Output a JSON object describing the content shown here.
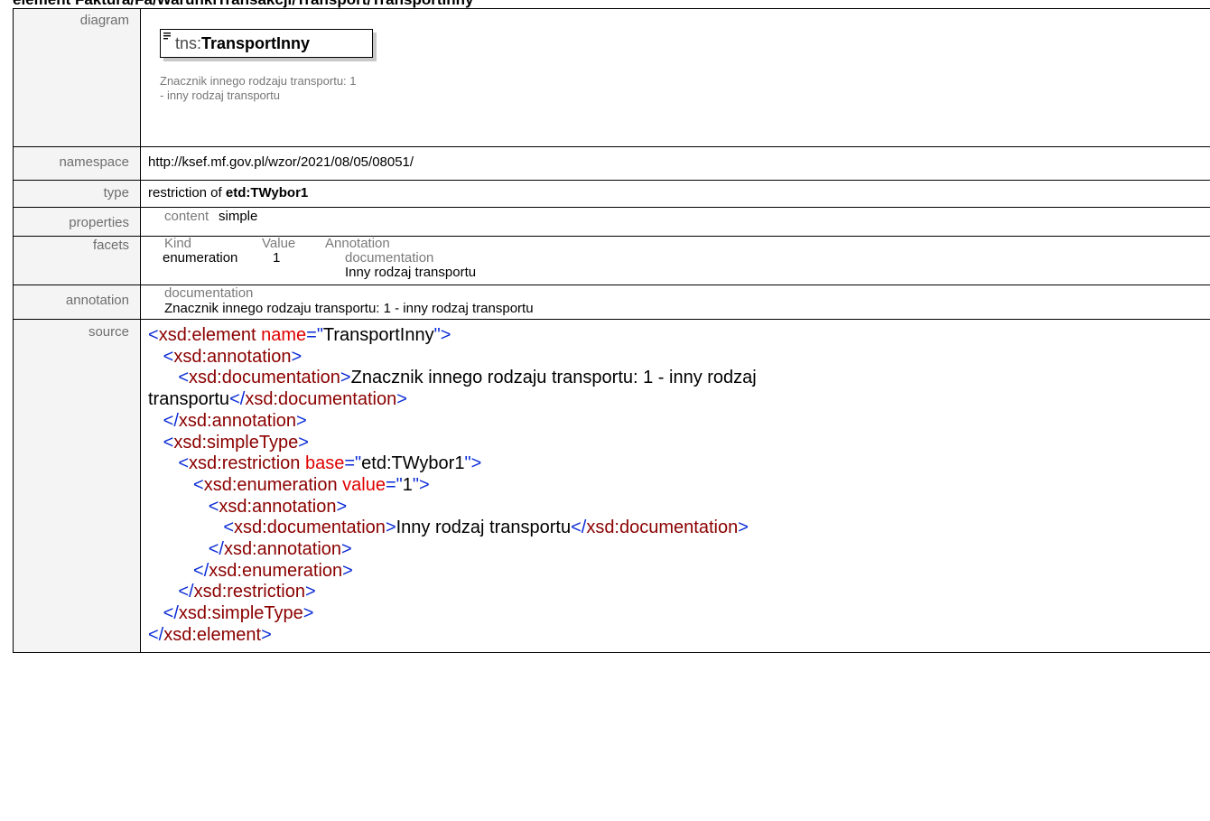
{
  "header": {
    "title": "element Faktura/Fa/WarunkiTransakcji/Transport/TransportInny"
  },
  "labels": {
    "diagram": "diagram",
    "namespace": "namespace",
    "type": "type",
    "properties": "properties",
    "facets": "facets",
    "annotation": "annotation",
    "source": "source"
  },
  "diagram": {
    "prefix": "tns:",
    "name": "TransportInny",
    "annotation": "Znacznik innego rodzaju transportu: 1 - inny rodzaj transportu"
  },
  "namespace": "http://ksef.mf.gov.pl/wzor/2021/08/05/08051/",
  "type": {
    "prefix": "restriction of ",
    "base": "etd:TWybor1"
  },
  "properties": {
    "key": "content",
    "value": "simple"
  },
  "facets": {
    "headers": {
      "kind": "Kind",
      "value": "Value",
      "annotation": "Annotation"
    },
    "row": {
      "kind": "enumeration",
      "value": "1",
      "doc_label": "documentation",
      "doc_text": "Inny rodzaj transportu"
    }
  },
  "annotation": {
    "head": "documentation",
    "text": "Znacznik innego rodzaju transportu: 1 - inny rodzaj transportu"
  },
  "source": {
    "lt": "<",
    "gt": ">",
    "close": "</",
    "eq": "=",
    "q": "\"",
    "el": "xsd:element",
    "el_attr": "name",
    "el_val": "TransportInny",
    "ann": "xsd:annotation",
    "doc": "xsd:documentation",
    "doc_text_1": "Znacznik innego rodzaju transportu: 1 - inny rodzaj",
    "doc_text_2": "transportu",
    "st": "xsd:simpleType",
    "res": "xsd:restriction",
    "res_attr": "base",
    "res_val": "etd:TWybor1",
    "enum": "xsd:enumeration",
    "enum_attr": "value",
    "enum_val": "1",
    "enum_doc": "Inny rodzaj transportu"
  }
}
